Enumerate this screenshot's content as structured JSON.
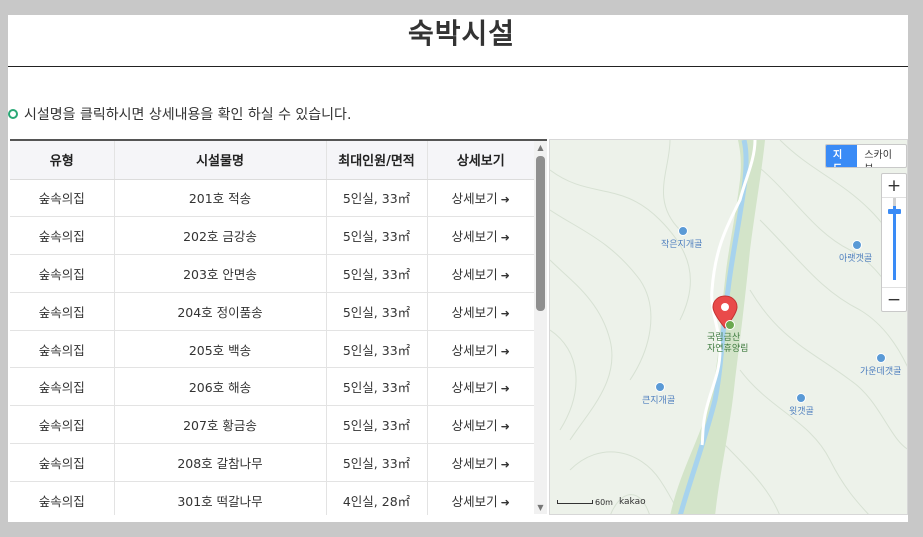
{
  "page": {
    "title": "숙박시설",
    "hint": "시설명을 클릭하시면 상세내용을 확인 하실 수 있습니다."
  },
  "table": {
    "headers": [
      "유형",
      "시설물명",
      "최대인원/면적",
      "상세보기"
    ],
    "rows": [
      {
        "type": "숲속의집",
        "name": "201호 적송",
        "capacity": "5인실, 33㎡",
        "detail": "상세보기"
      },
      {
        "type": "숲속의집",
        "name": "202호 금강송",
        "capacity": "5인실, 33㎡",
        "detail": "상세보기"
      },
      {
        "type": "숲속의집",
        "name": "203호 안면송",
        "capacity": "5인실, 33㎡",
        "detail": "상세보기"
      },
      {
        "type": "숲속의집",
        "name": "204호 정이품송",
        "capacity": "5인실, 33㎡",
        "detail": "상세보기"
      },
      {
        "type": "숲속의집",
        "name": "205호 백송",
        "capacity": "5인실, 33㎡",
        "detail": "상세보기"
      },
      {
        "type": "숲속의집",
        "name": "206호 해송",
        "capacity": "5인실, 33㎡",
        "detail": "상세보기"
      },
      {
        "type": "숲속의집",
        "name": "207호 황금송",
        "capacity": "5인실, 33㎡",
        "detail": "상세보기"
      },
      {
        "type": "숲속의집",
        "name": "208호 갈참나무",
        "capacity": "5인실, 33㎡",
        "detail": "상세보기"
      },
      {
        "type": "숲속의집",
        "name": "301호 떡갈나무",
        "capacity": "4인실, 28㎡",
        "detail": "상세보기"
      }
    ]
  },
  "map": {
    "map_button": "지도",
    "skyview_button": "스카이뷰",
    "zoom_in": "+",
    "zoom_out": "−",
    "marker_label_line1": "국립금산",
    "marker_label_line2": "자연휴양림",
    "place_labels": [
      "작은지개골",
      "아랫갯골",
      "가운데갯골",
      "큰지개골",
      "윗갯골"
    ],
    "scale_label": "60m",
    "provider": "kakao",
    "colors": {
      "accent": "#3a8bf6",
      "marker": "#e94a4a",
      "river": "#a7d3ee",
      "valley": "#cfe3c4"
    }
  }
}
